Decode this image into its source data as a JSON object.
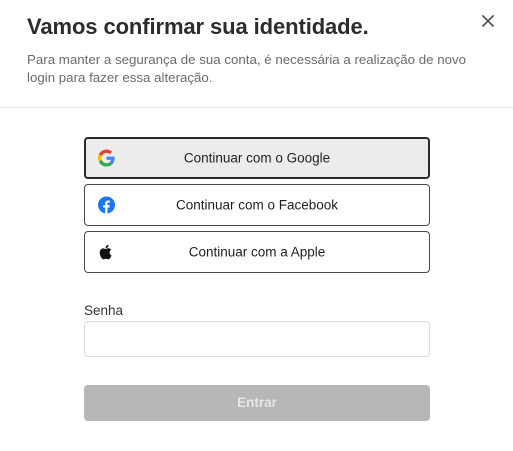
{
  "dialog": {
    "title": "Vamos confirmar sua identidade.",
    "subtitle": "Para manter a segurança de sua conta, é necessária a realização de novo login para fazer essa alteração.",
    "close_icon": "close-icon"
  },
  "auth_options": [
    {
      "label": "Continuar com o Google",
      "icon": "google-icon",
      "state": "hovered"
    },
    {
      "label": "Continuar com o Facebook",
      "icon": "facebook-icon"
    },
    {
      "label": "Continuar com a Apple",
      "icon": "apple-icon"
    }
  ],
  "password": {
    "label": "Senha",
    "value": "",
    "placeholder": ""
  },
  "submit": {
    "label": "Entrar",
    "disabled": true
  },
  "colors": {
    "google_blue": "#4285F4",
    "google_red": "#EA4335",
    "google_yellow": "#FBBC05",
    "google_green": "#34A853",
    "facebook_blue": "#1877F2",
    "disabled_button": "#b7b7b7"
  }
}
